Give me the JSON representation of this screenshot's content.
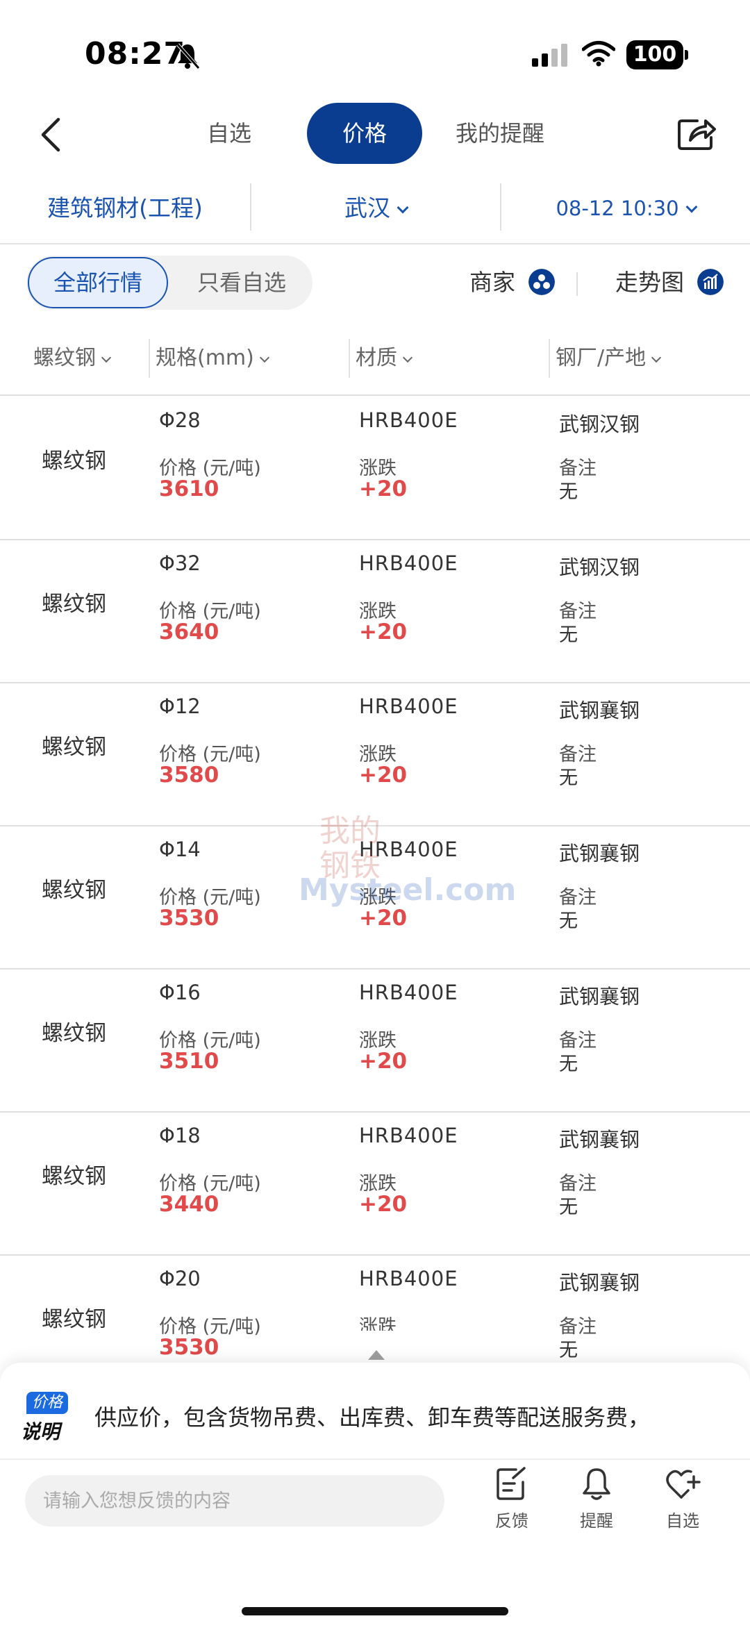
{
  "status_bar": {
    "time": "08:27",
    "battery": "100"
  },
  "nav": {
    "tabs": [
      {
        "label": "自选"
      },
      {
        "label": "价格"
      },
      {
        "label": "我的提醒"
      }
    ]
  },
  "filter": {
    "category": "建筑钢材(工程)",
    "city": "武汉",
    "datetime": "08-12 10:30"
  },
  "segment": {
    "all": "全部行情",
    "mine": "只看自选"
  },
  "tools": {
    "merchant": "商家",
    "trend": "走势图"
  },
  "columns": {
    "product": "螺纹钢",
    "spec": "规格(mm)",
    "material": "材质",
    "mill": "钢厂/产地"
  },
  "row_labels": {
    "price": "价格 (元/吨)",
    "change": "涨跌",
    "note": "备注"
  },
  "rows": [
    {
      "name": "螺纹钢",
      "spec": "Φ28",
      "material": "HRB400E",
      "mill": "武钢汉钢",
      "price": "3610",
      "change": "+20",
      "note": "无"
    },
    {
      "name": "螺纹钢",
      "spec": "Φ32",
      "material": "HRB400E",
      "mill": "武钢汉钢",
      "price": "3640",
      "change": "+20",
      "note": "无"
    },
    {
      "name": "螺纹钢",
      "spec": "Φ12",
      "material": "HRB400E",
      "mill": "武钢襄钢",
      "price": "3580",
      "change": "+20",
      "note": "无"
    },
    {
      "name": "螺纹钢",
      "spec": "Φ14",
      "material": "HRB400E",
      "mill": "武钢襄钢",
      "price": "3530",
      "change": "+20",
      "note": "无"
    },
    {
      "name": "螺纹钢",
      "spec": "Φ16",
      "material": "HRB400E",
      "mill": "武钢襄钢",
      "price": "3510",
      "change": "+20",
      "note": "无"
    },
    {
      "name": "螺纹钢",
      "spec": "Φ18",
      "material": "HRB400E",
      "mill": "武钢襄钢",
      "price": "3440",
      "change": "+20",
      "note": "无"
    },
    {
      "name": "螺纹钢",
      "spec": "Φ20",
      "material": "HRB400E",
      "mill": "武钢襄钢",
      "price": "3530",
      "change": "",
      "note": "无"
    }
  ],
  "watermark": {
    "cn": "我的钢铁",
    "en": "Mysteel.com"
  },
  "price_note": {
    "badge_top": "价格",
    "badge_bottom": "说明",
    "text": "供应价，包含货物吊费、出库费、卸车费等配送服务费，"
  },
  "feedback": {
    "placeholder": "请输入您想反馈的内容"
  },
  "actions": {
    "feedback": "反馈",
    "remind": "提醒",
    "favorite": "自选"
  },
  "colors": {
    "brand": "#0a3d8f",
    "link": "#1b54b0",
    "up": "#e04a4a"
  }
}
